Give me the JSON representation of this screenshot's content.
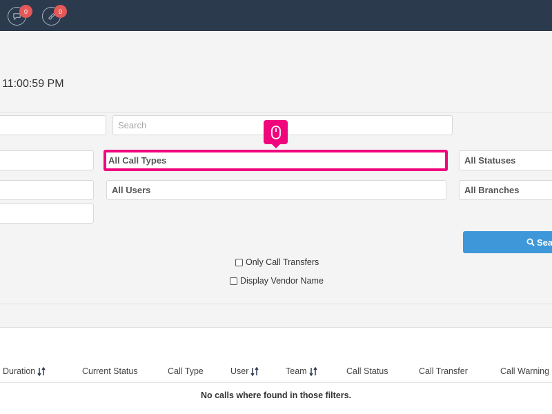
{
  "topbar": {
    "chat_badge": "0",
    "ticket_badge": "0"
  },
  "clock": "11:00:59 PM",
  "filters": {
    "search_placeholder": "Search",
    "call_types": "All Call Types",
    "statuses": "All Statuses",
    "users": "All Users",
    "branches": "All Branches"
  },
  "search_button_label": "Sea",
  "checkboxes": {
    "only_transfers": "Only Call Transfers",
    "vendor_name": "Display Vendor Name"
  },
  "table": {
    "headers": {
      "duration": "Duration",
      "current_status": "Current Status",
      "call_type": "Call Type",
      "user": "User",
      "team": "Team",
      "call_status": "Call Status",
      "call_transfer": "Call Transfer",
      "call_warning": "Call Warning"
    },
    "empty_message": "No calls where found in those filters."
  },
  "colors": {
    "topbar": "#2c3a4e",
    "highlight": "#f0057d",
    "badge": "#e45858",
    "button": "#3e97d8"
  },
  "icons": [
    "chat-bubble-icon",
    "ticket-icon",
    "mouse-icon",
    "search-icon",
    "sort-icon"
  ]
}
